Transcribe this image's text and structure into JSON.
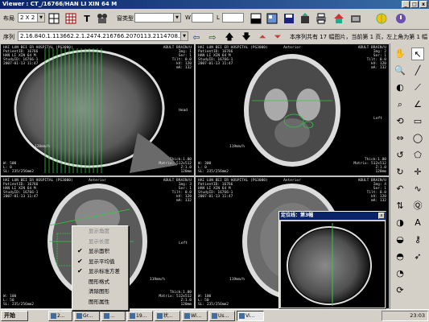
{
  "window": {
    "title": "Viewer : CT_/16766/HAN LI XIN 64 M",
    "controls": [
      "_",
      "□",
      "x"
    ]
  },
  "toolbar1": {
    "layout_label": "布局",
    "layout_value": "2 X 2",
    "window_type_label": "窗类型",
    "window_type_value": "",
    "w_label": "W",
    "w_value": "",
    "l_label": "L",
    "l_value": ""
  },
  "toolbar2": {
    "sequence_label": "序列",
    "sequence_value": "2.16.840.1.113662.2.1.2474.216766.2070113.2114708.2381633",
    "status_text": "本序列共有 17 幅图片，当前第 1 页，左上角为第 1 幅"
  },
  "panes": [
    {
      "tl": "HAI LUN BEI ER HOSPITAL (PG3000)\nPatientID: 16766\nHAN LI XIN 64 M\nStudyID: 16766-1\n2007-01-13 11:47",
      "tr": "ADULT BRAIN/U\nImg: 1\nSer: 1\nTilt: 0.0\nkV: 120\nmA: 132",
      "tc": "",
      "bl": "W: 500\nL: 0\nSL: 235/256mm2",
      "br": "Thick:1.00\nMatrix: 512x512\nZ:1.0\n120mm",
      "side": "Head",
      "scale": "120mm/h"
    },
    {
      "tl": "HAI LUN BEI ER HOSPITAL (PG3000)\nPatientID: 16766\nHAN LI XIN 64 M\nStudyID: 16766-1\n2007-01-13 11:47",
      "tr": "ADULT BRAIN/U\nImg: 2\nSer: 1\nTilt: 0.0\nkV: 120\nmA: 132",
      "tc": "Anterior",
      "bl": "W: 300\nL: 0\nSL: 235/256mm2",
      "br": "Thick:1.00\nMatrix: 512x512\nZ:1.0\n120mm",
      "side": "Left",
      "scale": "119mm/h"
    },
    {
      "tl": "HAI LUN BEI ER HOSPITAL (PG3000)\nPatientID: 16766\nHAN LI XIN 64 M\nStudyID: 16766-1\n2007-01-13 11:47",
      "tr": "ADULT BRAIN/U\nImg: 3\nSer: 1\nTilt: 0.0\nkV: 120\nmA: 132",
      "tc": "Anterior",
      "bl": "W: 100\nL: 50\nSL: 235/256mm2",
      "br": "Thick:1.00\nMatrix: 512x512\nZ:1.0\n120mm",
      "side": "Left",
      "scale": "119mm/h"
    },
    {
      "tl": "HAI LUN BEI ER HOSPITAL (PG3000)\nPatientID: 16766\nHAN LI XIN 64 M\nStudyID: 16766-1\n2007-01-13 11:47",
      "tr": "ADULT BRAIN/U\nImg: 4\nSer: 1\nTilt: 0.0\nkV: 120\nmA: 132",
      "tc": "Anterior",
      "bl": "W: 100\nL: 50\nSL: 235/256mm2",
      "br": "Thick:1.00\nMatrix: 512x512\nZ:1.0\n120mm",
      "side": "Left",
      "scale": "119mm/h"
    }
  ],
  "context_menu": {
    "items": [
      {
        "label": "显示角度",
        "checked": false,
        "disabled": true
      },
      {
        "label": "显示长度",
        "checked": false,
        "disabled": true
      },
      {
        "label": "显示面积",
        "checked": true,
        "disabled": false
      },
      {
        "label": "显示平均值",
        "checked": true,
        "disabled": false
      },
      {
        "label": "显示标准方差",
        "checked": true,
        "disabled": false
      },
      {
        "label": "图形格式",
        "checked": false,
        "disabled": false
      },
      {
        "label": "清除图形",
        "checked": false,
        "disabled": false
      },
      {
        "label": "图形属性",
        "checked": false,
        "disabled": false
      }
    ]
  },
  "popup": {
    "title": "定位线：第3幅",
    "close": "x"
  },
  "taskbar": {
    "start_label": "开始",
    "buttons": [
      "2...",
      "Gr...",
      "...",
      "19...",
      "状...",
      "Wi...",
      "Us...",
      "Vi..."
    ],
    "clock": "23:03"
  },
  "colors": {
    "titlebar": "#0a246a",
    "overlay_green": "#2ecc40"
  }
}
